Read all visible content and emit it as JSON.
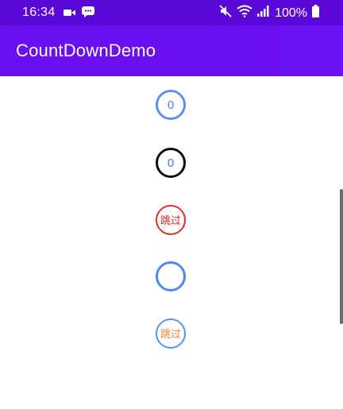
{
  "status_bar": {
    "time": "16:34",
    "battery_percent": "100%",
    "icons": [
      "video-icon",
      "chat-icon",
      "mute-icon",
      "wifi-icon",
      "signal-icon",
      "battery-icon"
    ]
  },
  "app_bar": {
    "title": "CountDownDemo"
  },
  "countdowns": [
    {
      "text": "0"
    },
    {
      "text": "0"
    },
    {
      "text": "跳过"
    },
    {
      "text": ""
    },
    {
      "text": "跳过"
    }
  ],
  "colors": {
    "status_bar": "#5a08d8",
    "app_bar": "#6a0ff2",
    "ring_blue": "#5b8ff6",
    "ring_black": "#0d0d0d",
    "ring_red": "#ec2a2a",
    "skip_orange": "#f0803c"
  }
}
